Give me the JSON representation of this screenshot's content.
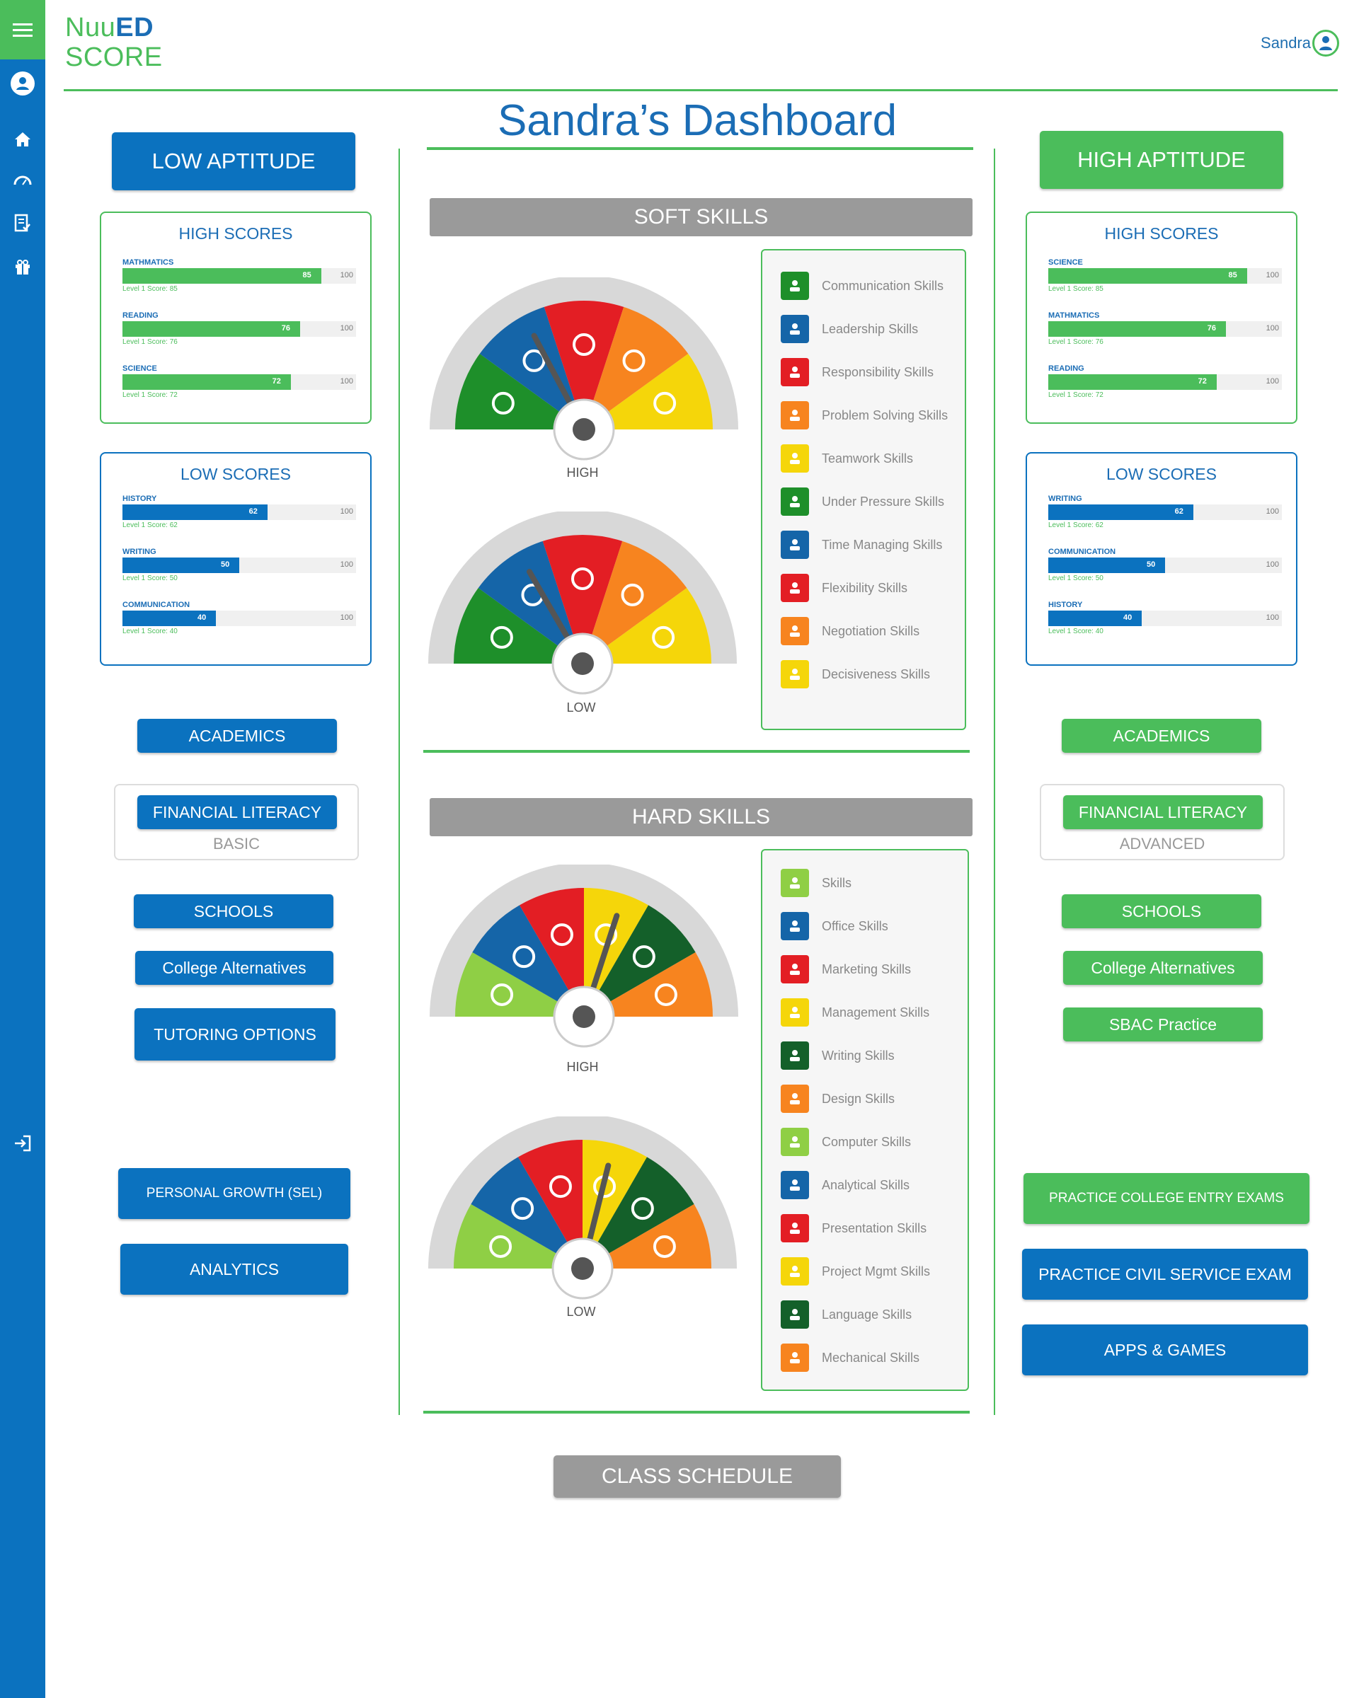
{
  "app": {
    "logo_line1": "NuuED",
    "logo_line1_a": "Nuu",
    "logo_line1_b": "ED",
    "logo_line2": "SCORE"
  },
  "header": {
    "user_name": "Sandra"
  },
  "title": "Sandra’s Dashboard",
  "sidebar": {
    "icons": [
      "menu-icon",
      "user-icon",
      "home-icon",
      "gauge-icon",
      "checklist-icon",
      "gift-icon",
      "logout-icon"
    ]
  },
  "left": {
    "aptitude_label": "LOW APTITUDE",
    "high_scores": {
      "title": "HIGH SCORES",
      "items": [
        {
          "subject": "MATHMATICS",
          "value": "85",
          "max": "100",
          "sub": "Level 1 Score: 85",
          "pct": 0.85
        },
        {
          "subject": "READING",
          "value": "76",
          "max": "100",
          "sub": "Level 1 Score: 76",
          "pct": 0.76
        },
        {
          "subject": "SCIENCE",
          "value": "72",
          "max": "100",
          "sub": "Level 1 Score: 72",
          "pct": 0.72
        }
      ]
    },
    "low_scores": {
      "title": "LOW SCORES",
      "items": [
        {
          "subject": "HISTORY",
          "value": "62",
          "max": "100",
          "sub": "Level 1 Score: 62",
          "pct": 0.62
        },
        {
          "subject": "WRITING",
          "value": "50",
          "max": "100",
          "sub": "Level 1 Score: 50",
          "pct": 0.5
        },
        {
          "subject": "COMMUNICATION",
          "value": "40",
          "max": "100",
          "sub": "Level 1 Score: 40",
          "pct": 0.4
        }
      ]
    },
    "academics": "ACADEMICS",
    "financial_literacy": "FINANCIAL LITERACY",
    "financial_level": "BASIC",
    "schools": "SCHOOLS",
    "college_alternatives": "College Alternatives",
    "tutoring": "TUTORING OPTIONS",
    "personal_growth": "PERSONAL GROWTH (SEL)",
    "analytics": "ANALYTICS"
  },
  "right": {
    "aptitude_label": "HIGH APTITUDE",
    "high_scores": {
      "title": "HIGH SCORES",
      "items": [
        {
          "subject": "SCIENCE",
          "value": "85",
          "max": "100",
          "sub": "Level 1 Score: 85",
          "pct": 0.85
        },
        {
          "subject": "MATHMATICS",
          "value": "76",
          "max": "100",
          "sub": "Level 1 Score: 76",
          "pct": 0.76
        },
        {
          "subject": "READING",
          "value": "72",
          "max": "100",
          "sub": "Level 1 Score: 72",
          "pct": 0.72
        }
      ]
    },
    "low_scores": {
      "title": "LOW SCORES",
      "items": [
        {
          "subject": "WRITING",
          "value": "62",
          "max": "100",
          "sub": "Level 1 Score: 62",
          "pct": 0.62
        },
        {
          "subject": "COMMUNICATION",
          "value": "50",
          "max": "100",
          "sub": "Level 1 Score: 50",
          "pct": 0.5
        },
        {
          "subject": "HISTORY",
          "value": "40",
          "max": "100",
          "sub": "Level 1 Score: 40",
          "pct": 0.4
        }
      ]
    },
    "academics": "ACADEMICS",
    "financial_literacy": "FINANCIAL LITERACY",
    "financial_level": "ADVANCED",
    "schools": "SCHOOLS",
    "college_alternatives": "College Alternatives",
    "sbac": "SBAC Practice",
    "college_entry": "PRACTICE COLLEGE ENTRY EXAMS",
    "civil_service": "PRACTICE CIVIL SERVICE EXAM",
    "apps_games": "APPS & GAMES"
  },
  "soft_skills": {
    "title": "SOFT SKILLS",
    "gauge_high_label": "HIGH",
    "gauge_low_label": "LOW",
    "items": [
      {
        "label": "Communication Skills",
        "color": "#1e8f2a",
        "icon": "people-icon"
      },
      {
        "label": "Leadership Skills",
        "color": "#1565a8",
        "icon": "presenter-icon"
      },
      {
        "label": "Responsibility Skills",
        "color": "#e31e24",
        "icon": "hands-heart-icon"
      },
      {
        "label": "Problem Solving Skills",
        "color": "#f7841f",
        "icon": "puzzle-icon"
      },
      {
        "label": "Teamwork Skills",
        "color": "#f5d60a",
        "icon": "team-cycle-icon"
      },
      {
        "label": "Under Pressure Skills",
        "color": "#1e8f2a",
        "icon": "pressure-gauge-icon"
      },
      {
        "label": "Time Managing Skills",
        "color": "#1565a8",
        "icon": "handshake-clock-icon"
      },
      {
        "label": "Flexibility Skills",
        "color": "#e31e24",
        "icon": "person-arrows-icon"
      },
      {
        "label": "Negotiation Skills",
        "color": "#f7841f",
        "icon": "clock-target-icon"
      },
      {
        "label": "Decisiveness Skills",
        "color": "#f5d60a",
        "icon": "decision-network-icon"
      }
    ]
  },
  "hard_skills": {
    "title": "HARD SKILLS",
    "gauge_high_label": "HIGH",
    "gauge_low_label": "LOW",
    "items": [
      {
        "label": "Skills",
        "color": "#8fcf45",
        "icon": "tools-icon"
      },
      {
        "label": "Office Skills",
        "color": "#1565a8",
        "icon": "folder-icon"
      },
      {
        "label": "Marketing Skills",
        "color": "#e31e24",
        "icon": "megaphone-icon"
      },
      {
        "label": "Management Skills",
        "color": "#f5d60a",
        "icon": "manager-icon"
      },
      {
        "label": "Writing Skills",
        "color": "#14602a",
        "icon": "pen-paper-icon"
      },
      {
        "label": "Design Skills",
        "color": "#f7841f",
        "icon": "ruler-icon"
      },
      {
        "label": "Computer Skills",
        "color": "#8fcf45",
        "icon": "computer-icon"
      },
      {
        "label": "Analytical Skills",
        "color": "#1565a8",
        "icon": "chart-search-icon"
      },
      {
        "label": "Presentation Skills",
        "color": "#e31e24",
        "icon": "presentation-chart-icon"
      },
      {
        "label": "Project Mgmt Skills",
        "color": "#f5d60a",
        "icon": "project-docs-icon"
      },
      {
        "label": "Language Skills",
        "color": "#14602a",
        "icon": "language-book-icon"
      },
      {
        "label": "Mechanical Skills",
        "color": "#f7841f",
        "icon": "gear-icon"
      }
    ]
  },
  "gauges": [
    {
      "id": "soft-high",
      "colors": [
        "#1e8f2a",
        "#1565a8",
        "#e31e24",
        "#f7841f",
        "#f5d60a"
      ],
      "needle_deg": -28
    },
    {
      "id": "soft-low",
      "colors": [
        "#1e8f2a",
        "#1565a8",
        "#e31e24",
        "#f7841f",
        "#f5d60a"
      ],
      "needle_deg": -30
    },
    {
      "id": "hard-high",
      "colors": [
        "#8fcf45",
        "#1565a8",
        "#e31e24",
        "#f5d60a",
        "#14602a",
        "#f7841f"
      ],
      "needle_deg": 18
    },
    {
      "id": "hard-low",
      "colors": [
        "#8fcf45",
        "#1565a8",
        "#e31e24",
        "#f5d60a",
        "#14602a",
        "#f7841f"
      ],
      "needle_deg": 14
    }
  ],
  "class_schedule": "CLASS SCHEDULE"
}
